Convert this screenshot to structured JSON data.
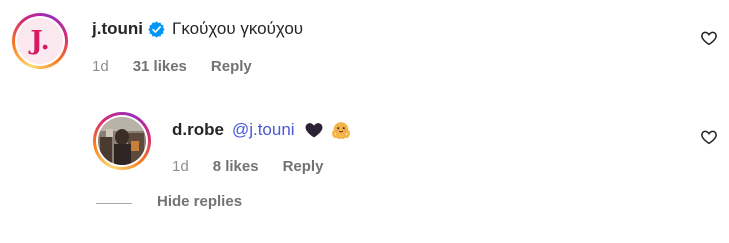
{
  "comments": [
    {
      "avatar_letter": "J.",
      "username": "j.touni",
      "verified": true,
      "text": "Γκούχου γκούχου",
      "time": "1d",
      "likes": "31 likes",
      "reply_label": "Reply"
    }
  ],
  "replies": [
    {
      "username": "d.robe",
      "mention": "@j.touni",
      "emojis": [
        "black-heart",
        "hugging-octopus"
      ],
      "time": "1d",
      "likes": "8 likes",
      "reply_label": "Reply"
    }
  ],
  "hide_replies_label": "Hide replies",
  "colors": {
    "mention": "#4a58d8",
    "verified": "#0095f6",
    "meta": "#737373"
  }
}
